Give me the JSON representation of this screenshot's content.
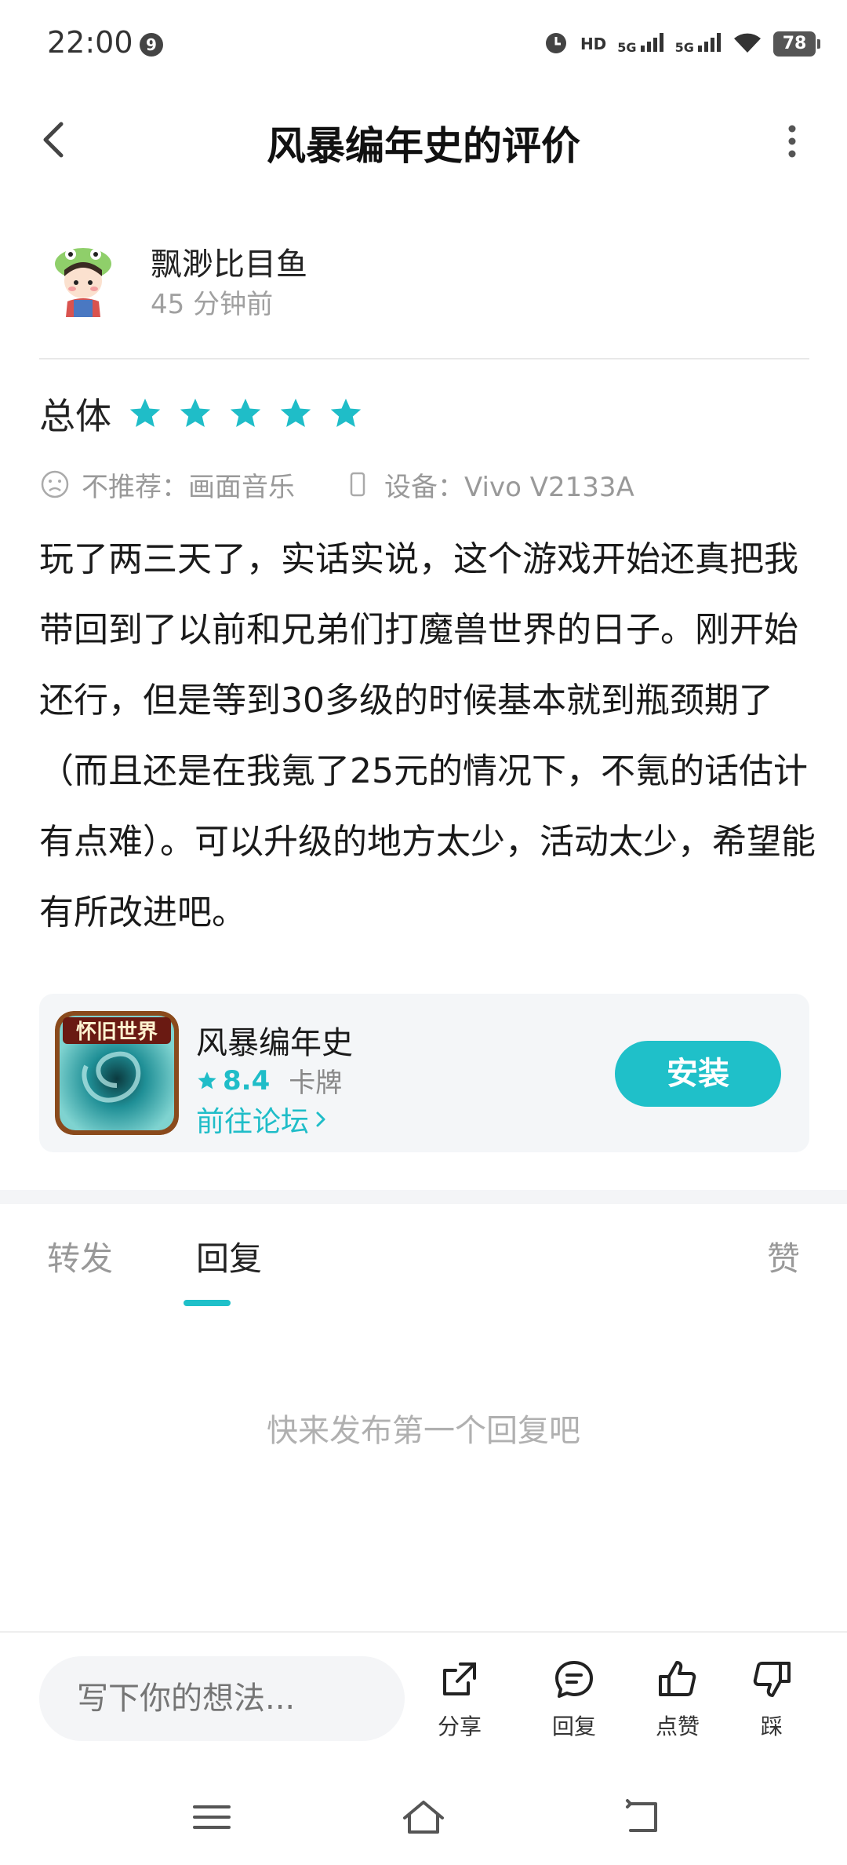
{
  "status_bar": {
    "time": "22:00",
    "notification_badge": "9",
    "hd_label": "HD",
    "signal1_label": "5G",
    "signal2_label": "5G",
    "battery": "78"
  },
  "header": {
    "title": "风暴编年史的评价"
  },
  "author": {
    "name": "飘渺比目鱼",
    "time_ago": "45 分钟前"
  },
  "rating": {
    "label": "总体",
    "stars": 5,
    "star_color": "#1fbdc8"
  },
  "meta": {
    "recommend": "不推荐：画面音乐",
    "device": "设备：Vivo V2133A"
  },
  "review": {
    "text": "玩了两三天了，实话实说，这个游戏开始还真把我带回到了以前和兄弟们打魔兽世界的日子。刚开始还行，但是等到30多级的时候基本就到瓶颈期了（而且还是在我氪了25元的情况下，不氪的话估计有点难）。可以升级的地方太少，活动太少，希望能有所改进吧。"
  },
  "app_card": {
    "icon_text": "怀旧世界",
    "name": "风暴编年史",
    "score": "8.4",
    "genre": "卡牌",
    "forum_link": "前往论坛",
    "install_label": "安装",
    "accent_color": "#1fc0c9"
  },
  "tabs": {
    "items": [
      {
        "label": "转发"
      },
      {
        "label": "回复"
      },
      {
        "label": "赞"
      }
    ],
    "active": "回复"
  },
  "empty_hint": "快来发布第一个回复吧",
  "action_bar": {
    "input_placeholder": "写下你的想法...",
    "share_label": "分享",
    "reply_label": "回复",
    "like_label": "点赞",
    "dislike_label": "踩"
  }
}
